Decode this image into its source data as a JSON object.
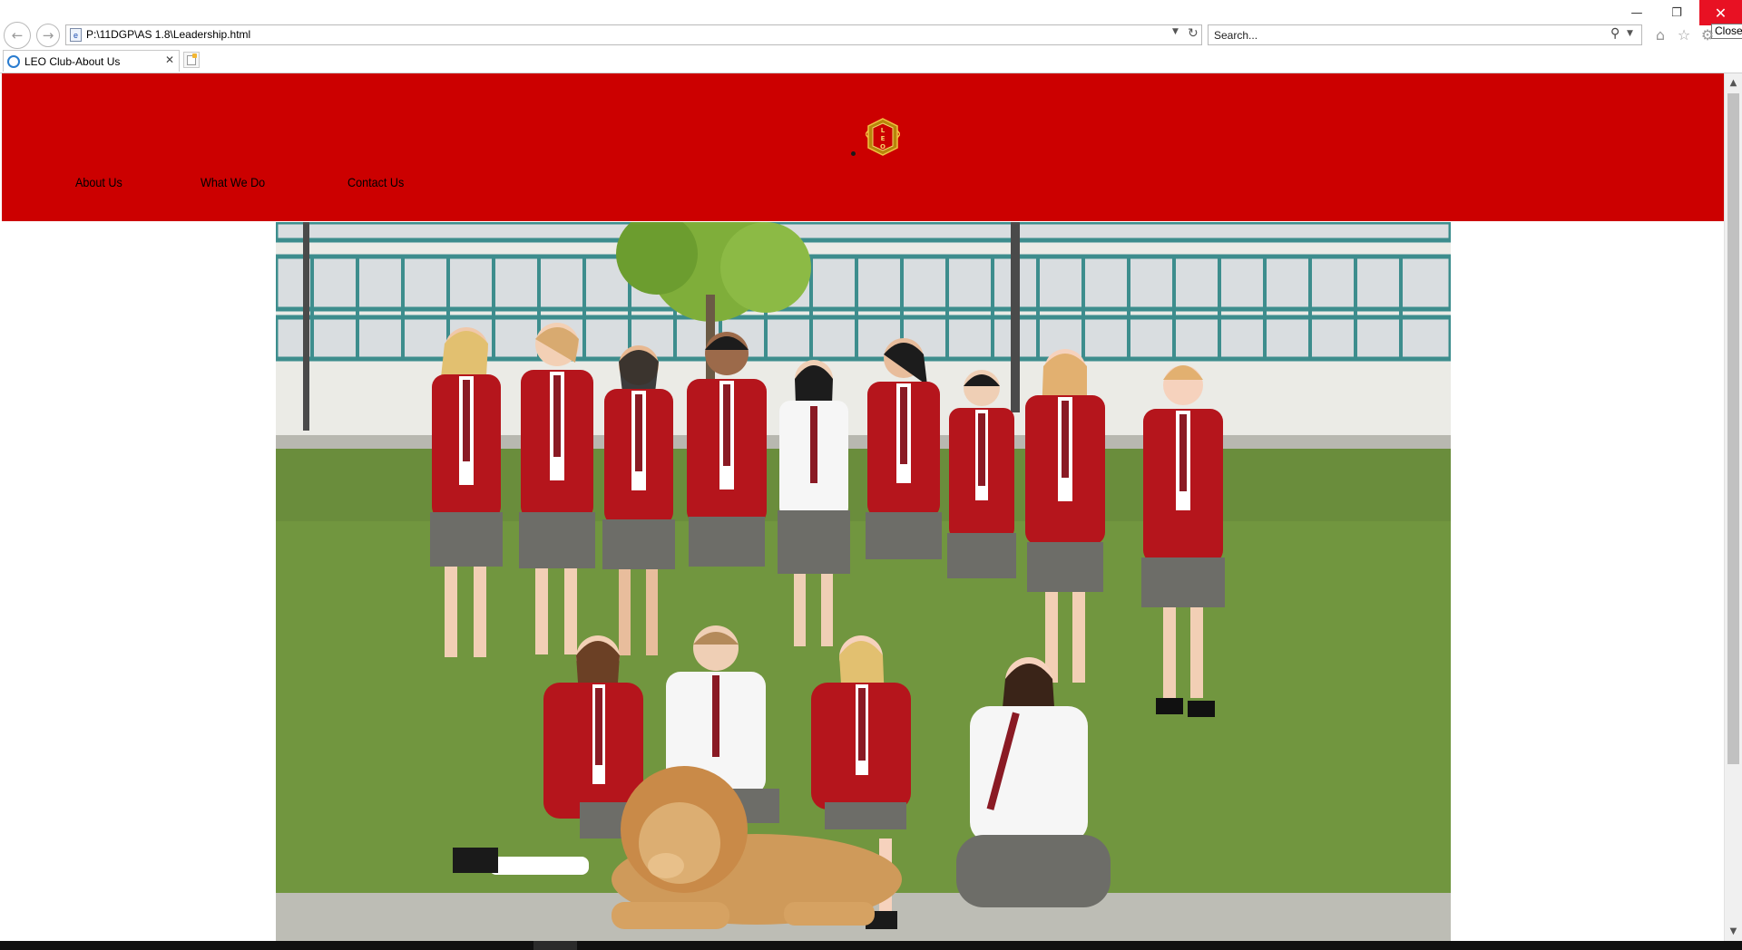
{
  "browser": {
    "address": "P:\\11DGP\\AS 1.8\\Leadership.html",
    "search_placeholder": "Search...",
    "tab_title": "LEO Club-About Us",
    "close_tooltip": "Close",
    "icons": {
      "back": "back-arrow-icon",
      "forward": "forward-arrow-icon",
      "refresh": "refresh-icon",
      "search": "search-icon",
      "home": "home-icon",
      "favorites": "star-icon",
      "tools": "gear-icon",
      "new_tab": "new-tab-icon",
      "window_close": "close-icon"
    }
  },
  "site": {
    "header_color": "#cc0000",
    "logo": {
      "text": "LEO"
    },
    "nav": {
      "about": "About Us",
      "what": "What We Do",
      "contact": "Contact Us"
    }
  }
}
